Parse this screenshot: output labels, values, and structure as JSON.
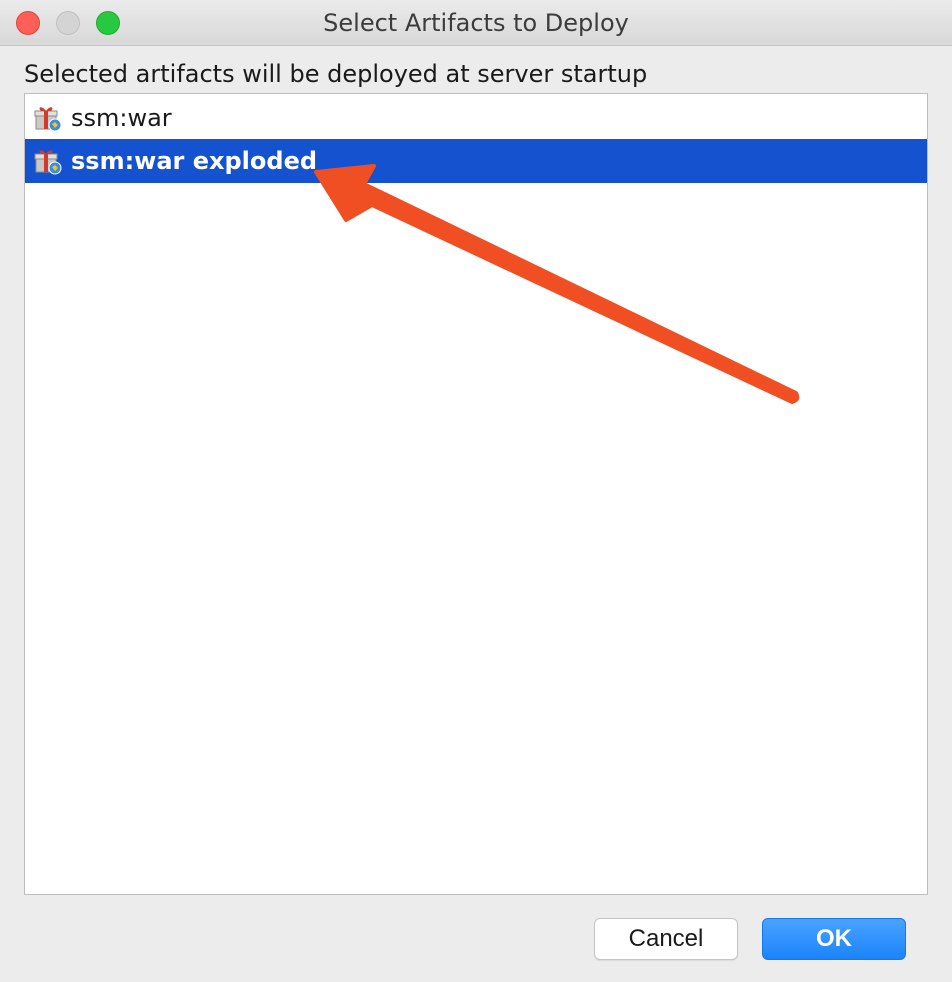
{
  "window": {
    "title": "Select Artifacts to Deploy"
  },
  "dialog": {
    "instruction": "Selected artifacts will be deployed at server startup",
    "artifacts": [
      {
        "label": "ssm:war",
        "icon": "artifact-gift-icon",
        "selected": false
      },
      {
        "label": "ssm:war exploded",
        "icon": "artifact-gift-icon",
        "selected": true
      }
    ]
  },
  "buttons": {
    "cancel_label": "Cancel",
    "ok_label": "OK"
  },
  "colors": {
    "selection": "#1452d0",
    "ok_button": "#1b84fb",
    "annotation_arrow": "#f04f23"
  }
}
